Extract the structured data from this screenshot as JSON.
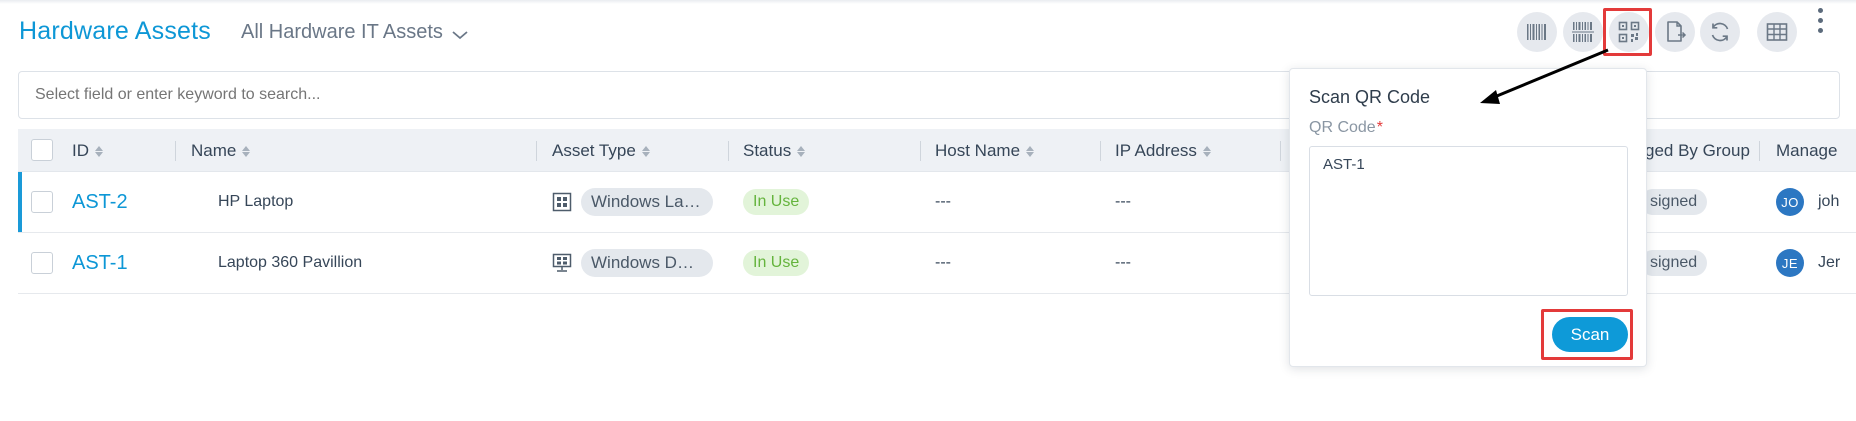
{
  "header": {
    "title": "Hardware Assets",
    "view_selector": "All Hardware IT Assets"
  },
  "toolbar": {
    "buttons": [
      {
        "name": "barcode-scan-icon"
      },
      {
        "name": "barcode-print-icon"
      },
      {
        "name": "qr-code-scan-icon"
      },
      {
        "name": "export-file-icon"
      },
      {
        "name": "refresh-icon"
      },
      {
        "name": "table-columns-icon"
      }
    ],
    "more": "kebab-menu-icon"
  },
  "search": {
    "placeholder": "Select field or enter keyword to search..."
  },
  "table": {
    "columns": {
      "id": "ID",
      "name": "Name",
      "asset_type": "Asset Type",
      "status": "Status",
      "host_name": "Host Name",
      "ip_address": "IP Address",
      "managed_by_group": "ged By Group",
      "managed_by": "Manage"
    },
    "rows": [
      {
        "id": "AST-2",
        "name": "HP Laptop",
        "asset_type": "Windows Lap...",
        "asset_type_icon": "windows-laptop-icon",
        "status": "In Use",
        "host_name": "---",
        "ip_address": "---",
        "group": "signed",
        "manager_initials": "JO",
        "manager_name": "joh"
      },
      {
        "id": "AST-1",
        "name": "Laptop 360 Pavillion",
        "asset_type": "Windows Des...",
        "asset_type_icon": "windows-desktop-icon",
        "status": "In Use",
        "host_name": "---",
        "ip_address": "---",
        "group": "signed",
        "manager_initials": "JE",
        "manager_name": "Jer"
      }
    ]
  },
  "popup": {
    "title": "Scan QR Code",
    "field_label": "QR Code",
    "required_marker": "*",
    "field_value": "AST-1",
    "scan_button": "Scan"
  },
  "colors": {
    "accent": "#0d97d6",
    "status_green": "#65b43d",
    "highlight_red": "#e33a3a"
  }
}
